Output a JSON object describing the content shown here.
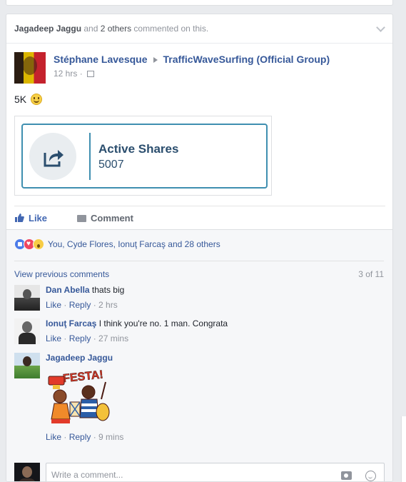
{
  "notice": {
    "name": "Jagadeep Jaggu",
    "conj": " and ",
    "others": "2 others",
    "suffix": " commented on this."
  },
  "post": {
    "author": "Stéphane Lavesque",
    "group": "TrafficWaveSurfing (Official Group)",
    "time": "12 hrs",
    "text": "5K",
    "share_card": {
      "title": "Active Shares",
      "count": "5007"
    }
  },
  "actions": {
    "like": "Like",
    "comment": "Comment"
  },
  "reactions": {
    "summary": "You, Cyde Flores, Ionuţ Farcaş and 28 others"
  },
  "comments": {
    "view_previous": "View previous comments",
    "count": "3 of 11",
    "items": [
      {
        "name": "Dan Abella",
        "text": "thats big",
        "like": "Like",
        "reply": "Reply",
        "time": "2 hrs"
      },
      {
        "name": "Ionuţ Farcaş",
        "text": "I think you're no. 1 man. Congrata",
        "like": "Like",
        "reply": "Reply",
        "time": "27 mins"
      },
      {
        "name": "Jagadeep Jaggu",
        "text": "",
        "sticker_text": "FESTA!",
        "like": "Like",
        "reply": "Reply",
        "time": "9 mins"
      }
    ]
  },
  "composer": {
    "placeholder": "Write a comment..."
  },
  "colors": {
    "link": "#365899",
    "like_blue": "#4267b2",
    "muted": "#90949c",
    "card_border": "#3f8fb0"
  }
}
